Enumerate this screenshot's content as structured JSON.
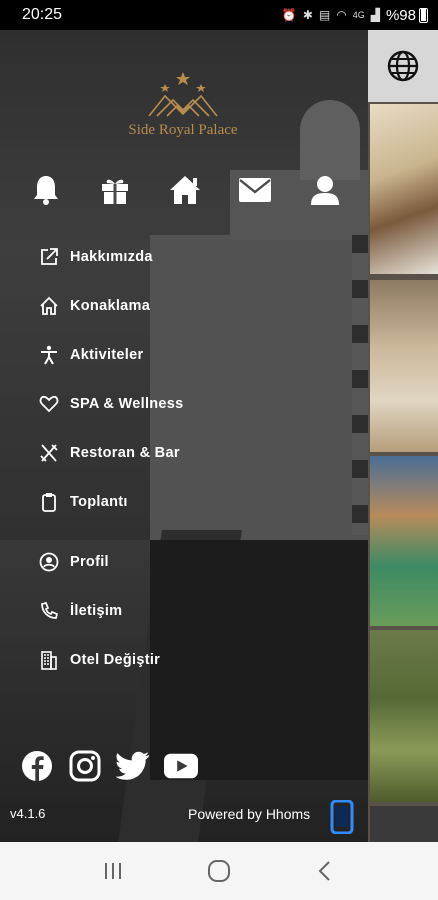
{
  "status_bar": {
    "time": "20:25",
    "network": "4G",
    "battery": "%98"
  },
  "hotel": {
    "name": "Side Royal Palace"
  },
  "menu": {
    "items": [
      {
        "label": "Hakkımızda",
        "icon": "external-link-icon"
      },
      {
        "label": "Konaklama",
        "icon": "home-outline-icon"
      },
      {
        "label": "Aktiviteler",
        "icon": "person-activity-icon"
      },
      {
        "label": "SPA & Wellness",
        "icon": "heart-outline-icon"
      },
      {
        "label": "Restoran & Bar",
        "icon": "utensils-icon"
      },
      {
        "label": "Toplantı",
        "icon": "clipboard-icon"
      },
      {
        "label": "Profil",
        "icon": "user-circle-icon"
      },
      {
        "label": "İletişim",
        "icon": "phone-icon"
      },
      {
        "label": "Otel Değiştir",
        "icon": "building-icon"
      }
    ]
  },
  "footer": {
    "version": "v4.1.6",
    "powered_by": "Powered by Hhoms"
  },
  "colors": {
    "gold": "#b78d4f",
    "accent_blue": "#2f8cff",
    "nav_bg": "#f5f5f5"
  }
}
